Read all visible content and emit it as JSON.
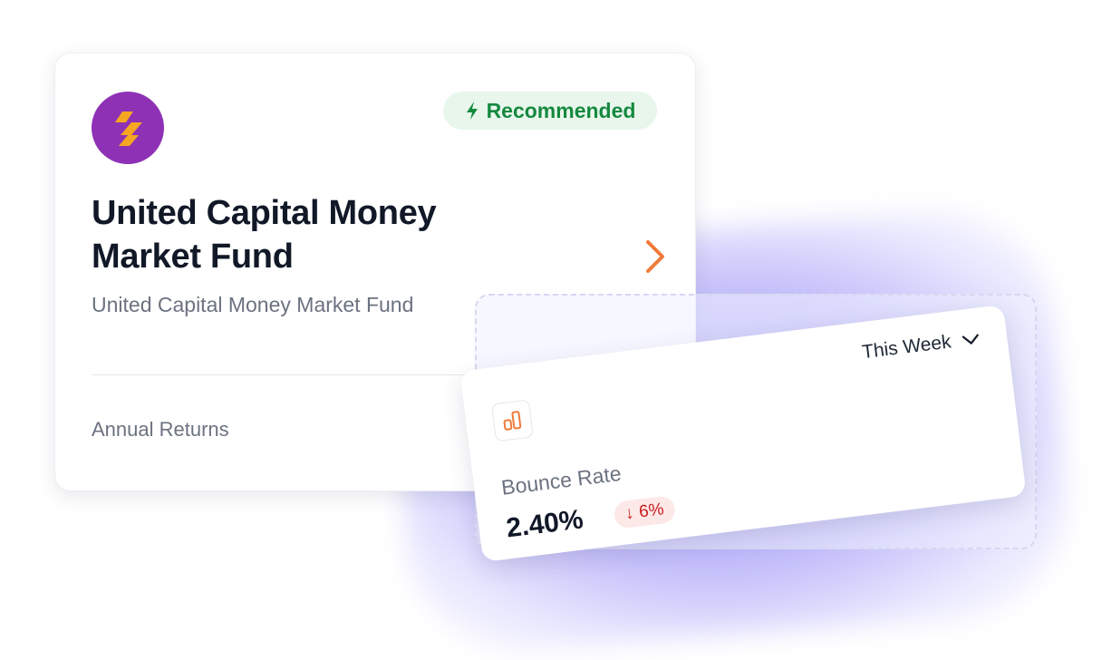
{
  "fund_card": {
    "logo_icon": "lightning-stripes-icon",
    "badge": {
      "icon": "lightning-bolt-icon",
      "label": "Recommended"
    },
    "title": "United Capital Money Market Fund",
    "subtitle": "United Capital Money Market Fund",
    "returns_label": "Annual Returns",
    "open_icon": "chevron-right-icon"
  },
  "stat_card": {
    "period": "This Week",
    "period_icon": "chevron-down-icon",
    "metric_icon": "bar-chart-icon",
    "label": "Bounce Rate",
    "value": "2.40%",
    "delta": {
      "arrow": "↓",
      "value": "6%"
    }
  },
  "colors": {
    "logo_bg": "#8e31b5",
    "logo_stripes": "#f5a623",
    "badge_bg": "#e8f6ec",
    "badge_text": "#15893f",
    "accent_orange": "#f07a3a",
    "delta_bg": "#fde8e8",
    "delta_text": "#c81e1e",
    "glow": "#7c6ff0"
  }
}
